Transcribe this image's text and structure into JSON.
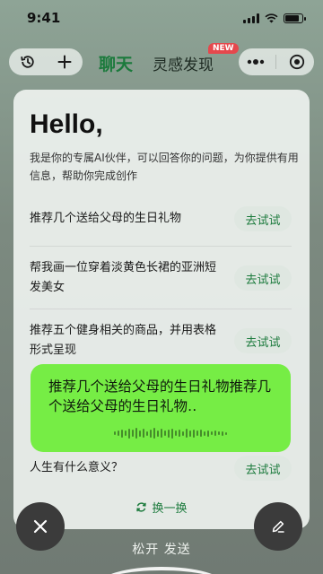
{
  "status_bar": {
    "time": "9:41"
  },
  "top_bar": {
    "history_icon": "history-icon",
    "add_icon": "plus-icon",
    "tab_chat": "聊天",
    "tab_inspire": "灵感发现",
    "new_badge": "NEW",
    "more_icon": "more-dots-icon",
    "target_icon": "target-icon"
  },
  "card": {
    "greeting": "Hello,",
    "intro": "我是你的专属AI伙伴，可以回答你的问题，为你提供有用信息，帮助你完成创作",
    "prompts": [
      {
        "text": "推荐几个送给父母的生日礼物",
        "button": "去试试"
      },
      {
        "text": "帮我画一位穿着淡黄色长裙的亚洲短发美女",
        "button": "去试试"
      },
      {
        "text": "推荐五个健身相关的商品，并用表格形式呈现",
        "button": "去试试"
      },
      {
        "text": "人生有什么意义？",
        "button": "去试试"
      }
    ],
    "refresh_label": "换一换"
  },
  "voice": {
    "transcript": "推荐几个送给父母的生日礼物推荐几个送给父母的生日礼物‥"
  },
  "bottom": {
    "release_hint": "松开 发送"
  },
  "colors": {
    "accent_green": "#1b7a3c",
    "voice_bubble": "#76ed45",
    "badge_red": "#e5484d"
  }
}
